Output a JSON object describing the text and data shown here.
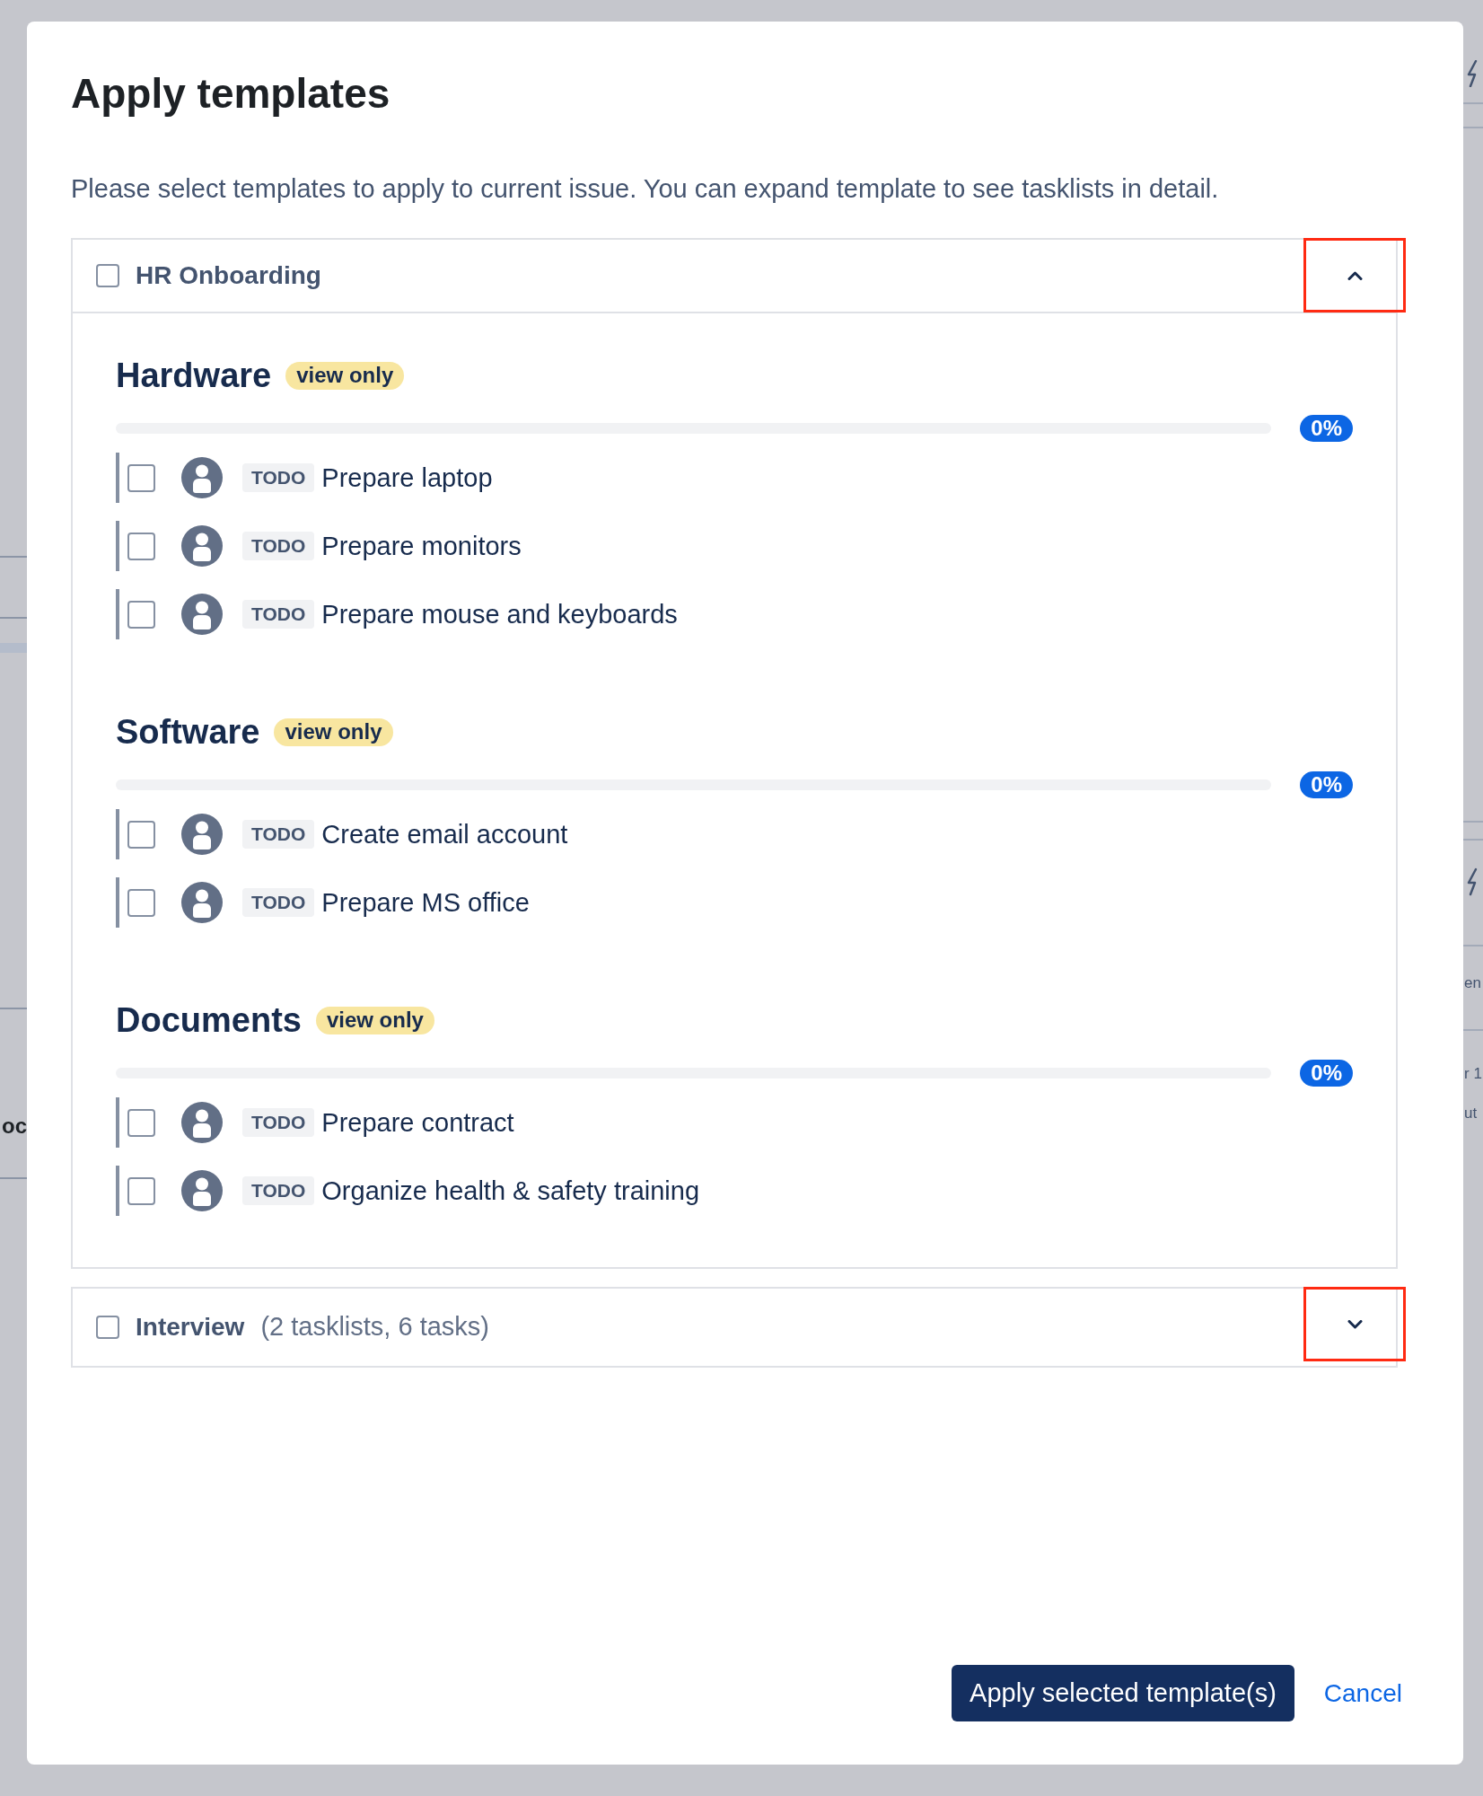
{
  "background_page": {
    "texts": [
      "oc",
      "en",
      "r 1",
      "ut"
    ]
  },
  "dialog": {
    "title": "Apply templates",
    "description": "Please select templates to apply to current issue. You can expand template to see tasklists in detail.",
    "templates": [
      {
        "name": "HR Onboarding",
        "checked": false,
        "expanded": true,
        "toggle_highlighted": true,
        "tasklists": [
          {
            "title": "Hardware",
            "badge": "view only",
            "level": 0,
            "percent": "0%",
            "tasks": [
              {
                "status": "TODO",
                "title": "Prepare laptop",
                "checked": false
              },
              {
                "status": "TODO",
                "title": "Prepare monitors",
                "checked": false
              },
              {
                "status": "TODO",
                "title": "Prepare mouse and keyboards",
                "checked": false
              }
            ]
          },
          {
            "title": "Software",
            "badge": "view only",
            "level": 0,
            "percent": "0%",
            "tasks": [
              {
                "status": "TODO",
                "title": "Create email account",
                "checked": false
              },
              {
                "status": "TODO",
                "title": "Prepare MS office",
                "checked": false
              }
            ]
          },
          {
            "title": "Documents",
            "badge": "view only",
            "level": 0,
            "percent": "0%",
            "tasks": [
              {
                "status": "TODO",
                "title": "Prepare contract",
                "checked": false
              },
              {
                "status": "TODO",
                "title": "Organize health & safety training",
                "checked": false
              }
            ]
          }
        ]
      },
      {
        "name": "Interview",
        "summary": "(2 tasklists, 6 tasks)",
        "checked": false,
        "expanded": false,
        "toggle_highlighted": true
      }
    ],
    "buttons": [
      {
        "label": "Apply selected template(s)",
        "kind": "primary"
      },
      {
        "label": "Cancel",
        "kind": "link"
      }
    ]
  }
}
